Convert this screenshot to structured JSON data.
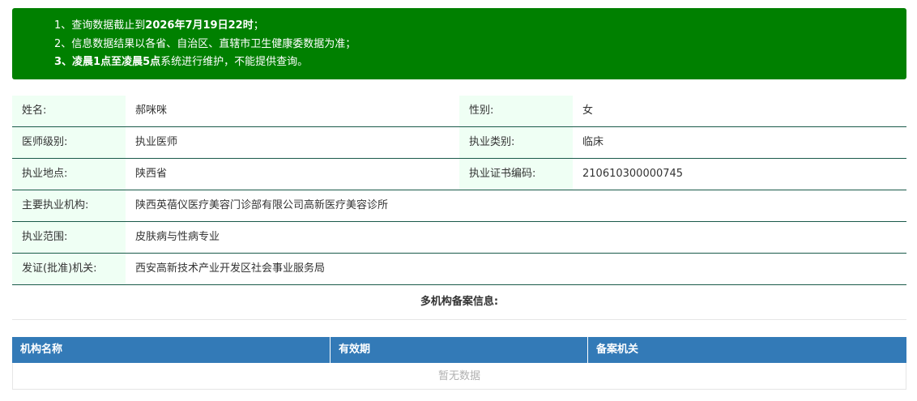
{
  "notice": {
    "line1_pre": "1、查询数据截止到",
    "line1_bold": "2026年7月19日22时",
    "line1_post": "；",
    "line2": "2、信息数据结果以各省、自治区、直辖市卫生健康委数据为准；",
    "line3_pre": "3、",
    "line3_bold": "凌晨1点至凌晨5点",
    "line3_post": "系统进行维护，不能提供查询。",
    "bg_color": "#008000"
  },
  "info": {
    "name_label": "姓名:",
    "name_value": "郝咪咪",
    "gender_label": "性别:",
    "gender_value": "女",
    "level_label": "医师级别:",
    "level_value": "执业医师",
    "category_label": "执业类别:",
    "category_value": "临床",
    "location_label": "执业地点:",
    "location_value": "陕西省",
    "cert_label": "执业证书编码:",
    "cert_value": "210610300000745",
    "org_label": "主要执业机构:",
    "org_value": "陕西英蓓仪医疗美容门诊部有限公司高新医疗美容诊所",
    "scope_label": "执业范围:",
    "scope_value": "皮肤病与性病专业",
    "issuer_label": "发证(批准)机关:",
    "issuer_value": "西安高新技术产业开发区社会事业服务局"
  },
  "multi": {
    "title": "多机构备案信息:",
    "columns": [
      "机构名称",
      "有效期",
      "备案机关"
    ],
    "empty_text": "暂无数据",
    "header_color": "#337ab7"
  }
}
